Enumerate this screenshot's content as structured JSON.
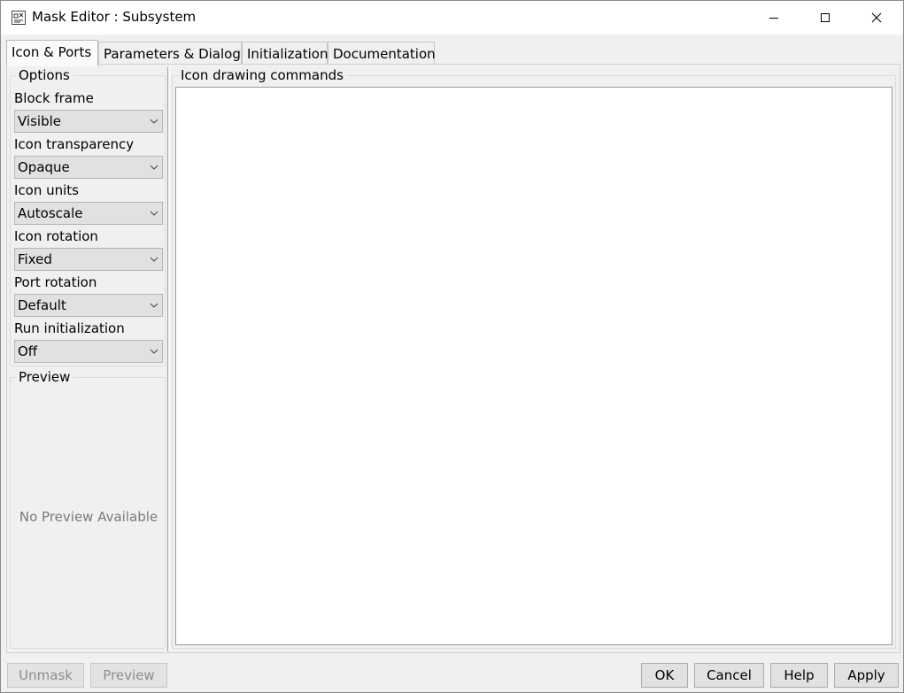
{
  "window": {
    "title": "Mask Editor : Subsystem",
    "icon": "mask-editor-app-icon",
    "controls": [
      "minimize-icon",
      "maximize-icon",
      "close-icon"
    ]
  },
  "tabs": [
    {
      "label": "Icon & Ports",
      "active": true
    },
    {
      "label": "Parameters & Dialog",
      "active": false
    },
    {
      "label": "Initialization",
      "active": false
    },
    {
      "label": "Documentation",
      "active": false
    }
  ],
  "options": {
    "title": "Options",
    "fields": [
      {
        "label": "Block frame",
        "value": "Visible"
      },
      {
        "label": "Icon transparency",
        "value": "Opaque"
      },
      {
        "label": "Icon units",
        "value": "Autoscale"
      },
      {
        "label": "Icon rotation",
        "value": "Fixed"
      },
      {
        "label": "Port rotation",
        "value": "Default"
      },
      {
        "label": "Run initialization",
        "value": "Off"
      }
    ]
  },
  "preview": {
    "title": "Preview",
    "empty_text": "No Preview Available"
  },
  "commands": {
    "title": "Icon drawing commands",
    "content": ""
  },
  "buttons": {
    "unmask": "Unmask",
    "preview": "Preview",
    "ok": "OK",
    "cancel": "Cancel",
    "help": "Help",
    "apply": "Apply"
  },
  "colors": {
    "window_bg": "#f0f0f0",
    "titlebar_bg": "#ffffff",
    "disabled_text": "#8d8d8d"
  }
}
